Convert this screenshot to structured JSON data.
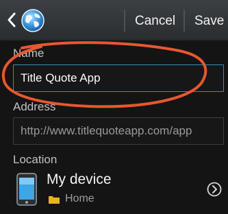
{
  "header": {
    "back_icon": "chevron-left-icon",
    "app_icon": "globe-icon",
    "cancel_label": "Cancel",
    "save_label": "Save"
  },
  "form": {
    "name": {
      "label": "Name",
      "value": "Title Quote App"
    },
    "address": {
      "label": "Address",
      "value": "http://www.titlequoteapp.com/app"
    },
    "location": {
      "label": "Location",
      "device": "My device",
      "folder": "Home",
      "folder_icon": "folder-icon",
      "device_icon": "phone-icon",
      "navigate_icon": "chevron-right-circle-icon"
    }
  },
  "colors": {
    "accent": "#2f8fc1",
    "annotation": "#e8572f",
    "folder": "#e8b41a"
  }
}
